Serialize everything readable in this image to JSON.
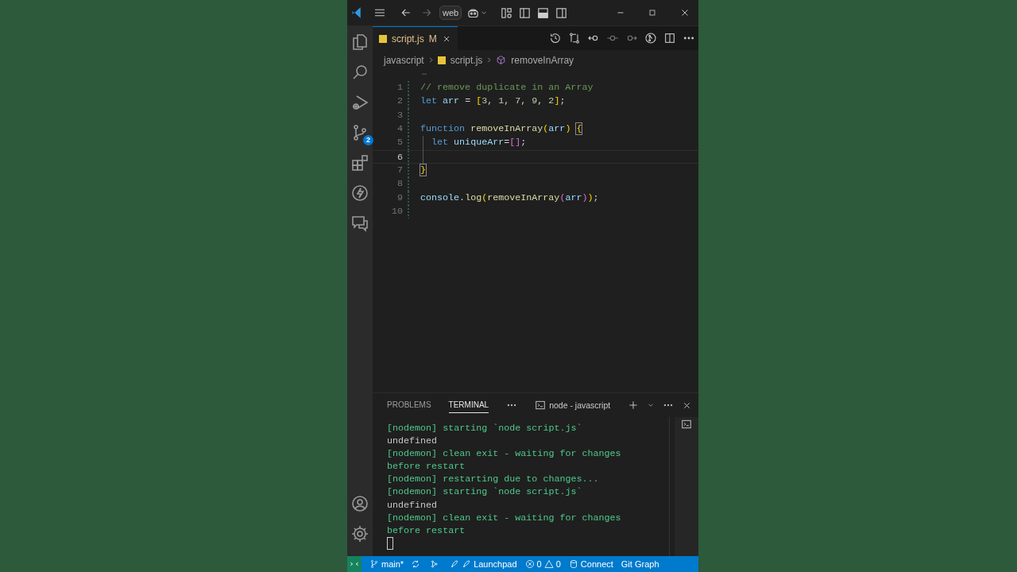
{
  "title_bar": {
    "profile_label": "web"
  },
  "tab": {
    "label": "script.js",
    "badge": "M",
    "modified": true
  },
  "breadcrumb": [
    {
      "label": "javascript",
      "kind": "folder"
    },
    {
      "label": "script.js",
      "kind": "file"
    },
    {
      "label": "removeInArray",
      "kind": "symbol"
    }
  ],
  "editor": {
    "overflow_marker": "…",
    "lines": [
      {
        "number": "1",
        "current": false,
        "text": "// remove duplicate in an Array"
      },
      {
        "number": "2",
        "current": false,
        "text": "let arr = [3, 1, 7, 9, 2];"
      },
      {
        "number": "3",
        "current": false
      },
      {
        "number": "4",
        "current": false,
        "matched_bracket": true,
        "text": "function removeInArray(arr) {"
      },
      {
        "number": "5",
        "current": false,
        "text": "  let uniqueArr=[];"
      },
      {
        "number": "6",
        "current": true
      },
      {
        "number": "7",
        "current": false,
        "matched_bracket": true,
        "text": "}"
      },
      {
        "number": "8",
        "current": false
      },
      {
        "number": "9",
        "current": false,
        "text": "console.log(removeInArray(arr));"
      },
      {
        "number": "10",
        "current": false
      }
    ]
  },
  "panel": {
    "tabs": [
      {
        "label": "PROBLEMS",
        "selected": false
      },
      {
        "label": "TERMINAL",
        "selected": true
      }
    ],
    "terminal_name": "node - javascript",
    "lines": [
      {
        "kind": "nodemon",
        "text": "[nodemon] starting `node script.js`"
      },
      {
        "kind": "output",
        "text": "undefined"
      },
      {
        "kind": "nodemon",
        "text": "[nodemon] clean exit - waiting for changes"
      },
      {
        "kind": "nodemon",
        "text": "before restart"
      },
      {
        "kind": "nodemon",
        "text": "[nodemon] restarting due to changes..."
      },
      {
        "kind": "nodemon",
        "text": "[nodemon] starting `node script.js`"
      },
      {
        "kind": "output",
        "text": "undefined"
      },
      {
        "kind": "nodemon",
        "text": "[nodemon] clean exit - waiting for changes"
      },
      {
        "kind": "nodemon",
        "text": "before restart"
      }
    ]
  },
  "activity_bar": {
    "items": [
      {
        "kind": "explorer"
      },
      {
        "kind": "search"
      },
      {
        "kind": "debug"
      },
      {
        "kind": "source-control",
        "badge": "2"
      },
      {
        "kind": "extensions"
      },
      {
        "kind": "lightning"
      },
      {
        "kind": "chat"
      }
    ],
    "bottom": [
      {
        "kind": "account"
      },
      {
        "kind": "settings"
      }
    ]
  },
  "status_bar": {
    "items": [
      {
        "kind": "remote"
      },
      {
        "kind": "branch",
        "text": "main*"
      },
      {
        "kind": "sync"
      },
      {
        "kind": "graph"
      },
      {
        "kind": "launchpad",
        "text": "Launchpad"
      },
      {
        "kind": "problems",
        "errors": "0",
        "warnings": "0"
      },
      {
        "kind": "connect",
        "text": "Connect"
      },
      {
        "kind": "plain",
        "text": "Git Graph"
      }
    ]
  }
}
